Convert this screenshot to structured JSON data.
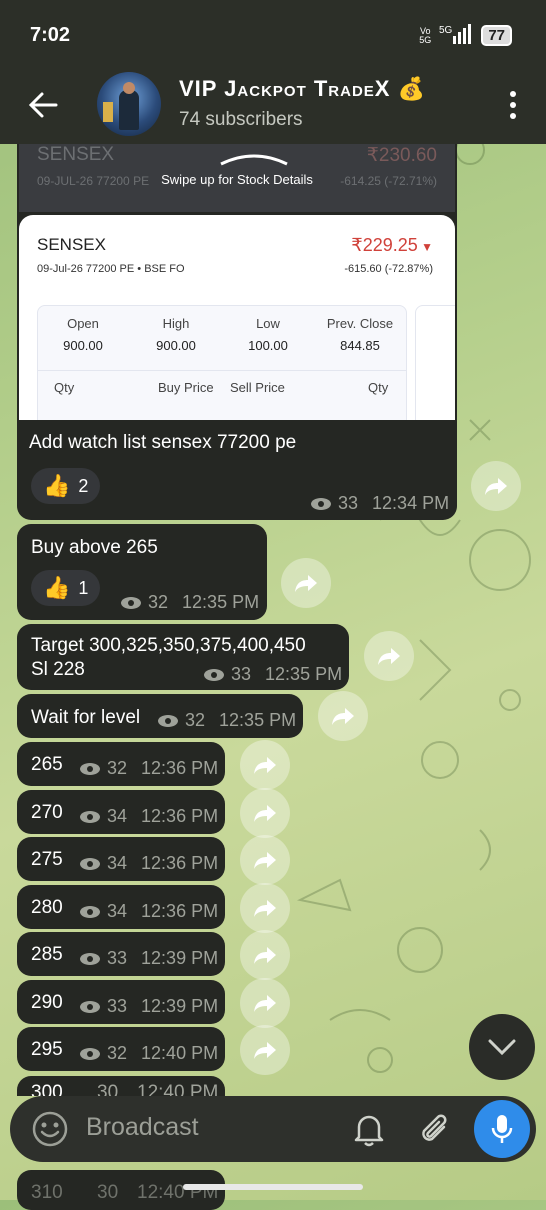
{
  "status_bar": {
    "time": "7:02",
    "network_left": "Vo\n5G",
    "network": "5G",
    "battery": "77"
  },
  "header": {
    "title": "VIP Jackpot TradeX",
    "title_emoji": "💰",
    "subtitle": "74 subscribers"
  },
  "image_message": {
    "swipe_text": "Swipe up for Stock Details",
    "ghost_name": "SENSEX",
    "ghost_sub": "09-JUL-26 77200 PE",
    "ghost_price": "₹230.60",
    "ghost_change": "-614.25 (-72.71%)",
    "name": "SENSEX",
    "price": "₹229.25",
    "sub": "09-Jul-26 77200 PE • BSE FO",
    "change": "-615.60  (-72.87%)",
    "grid": {
      "headers": [
        "Open",
        "High",
        "Low",
        "Prev. Close"
      ],
      "values": [
        "900.00",
        "900.00",
        "100.00",
        "844.85"
      ],
      "depth_headers": [
        "Qty",
        "Buy Price",
        "Sell Price",
        "Qty"
      ]
    },
    "caption": "Add watch list sensex 77200 pe",
    "reaction": {
      "emoji": "👍",
      "count": "2"
    },
    "views": "33",
    "time": "12:34 PM"
  },
  "messages": [
    {
      "text": "Buy above 265",
      "reaction_emoji": "👍",
      "reaction_count": "1",
      "views": "32",
      "time": "12:35 PM"
    },
    {
      "text_line1": "Target 300,325,350,375,400,450",
      "text_line2": "Sl 228",
      "views": "33",
      "time": "12:35 PM"
    },
    {
      "text": "Wait for level",
      "views": "32",
      "time": "12:35 PM"
    },
    {
      "text": "265",
      "views": "32",
      "time": "12:36 PM"
    },
    {
      "text": "270",
      "views": "34",
      "time": "12:36 PM"
    },
    {
      "text": "275",
      "views": "34",
      "time": "12:36 PM"
    },
    {
      "text": "280",
      "views": "34",
      "time": "12:36 PM"
    },
    {
      "text": "285",
      "views": "33",
      "time": "12:39 PM"
    },
    {
      "text": "290",
      "views": "33",
      "time": "12:39 PM"
    },
    {
      "text": "295",
      "views": "32",
      "time": "12:40 PM"
    },
    {
      "text": "300",
      "views": "30",
      "time": "12:40 PM"
    },
    {
      "text": "310",
      "views": "30",
      "time": "12:40 PM"
    }
  ],
  "input": {
    "placeholder": "Broadcast"
  },
  "colors": {
    "accent": "#2f8cea",
    "bubble": "#252723",
    "header": "#2c2f28",
    "price_down": "#d0413a"
  }
}
